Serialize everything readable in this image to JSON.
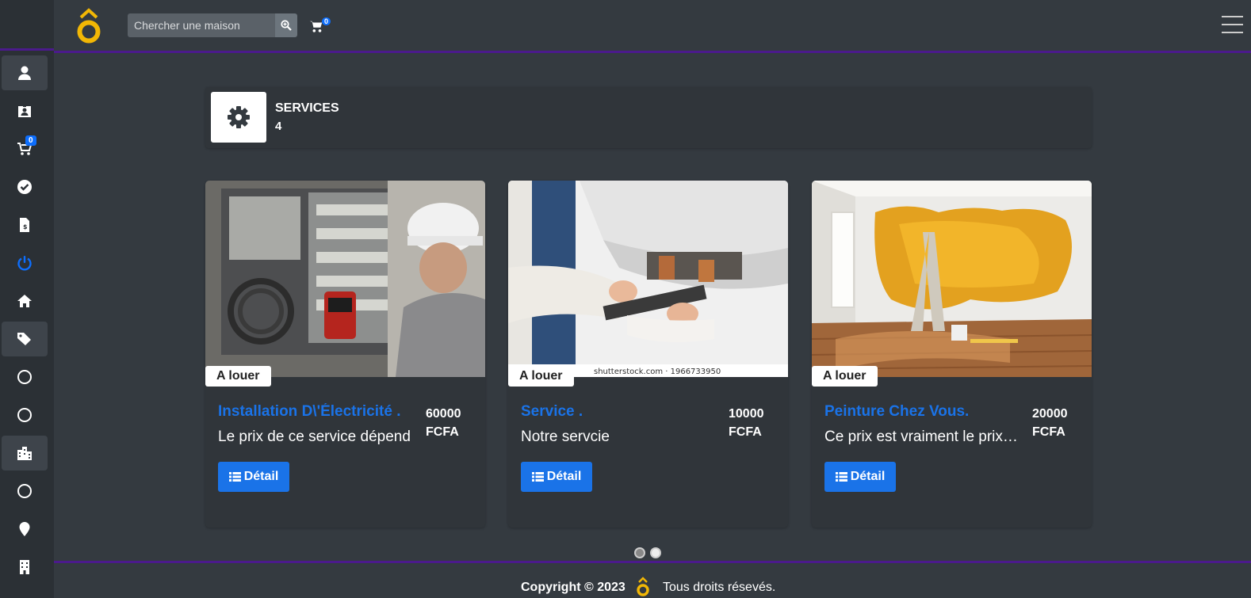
{
  "brand": {
    "logo_glyph": "ô",
    "accent_color": "#f2b705"
  },
  "header": {
    "search_placeholder": "Chercher une maison",
    "cart_count": "0"
  },
  "sidebar": {
    "cart_count": "0",
    "items": [
      {
        "icon": "user-icon",
        "active": true
      },
      {
        "icon": "id-card-icon"
      },
      {
        "icon": "cart-icon"
      },
      {
        "icon": "check-circle-icon"
      },
      {
        "icon": "invoice-icon"
      },
      {
        "icon": "power-icon",
        "color": "#0d6efd"
      },
      {
        "icon": "home-icon"
      },
      {
        "icon": "tags-icon",
        "active": true
      },
      {
        "icon": "circle-icon"
      },
      {
        "icon": "circle-icon"
      },
      {
        "icon": "city-icon",
        "active": true
      },
      {
        "icon": "circle-icon"
      },
      {
        "icon": "map-marker-icon"
      },
      {
        "icon": "building-icon"
      }
    ]
  },
  "services": {
    "title": "SERVICES",
    "count": "4"
  },
  "cards": [
    {
      "tag": "A louer",
      "title": "Installation D\\'Électricité .",
      "desc": "Le prix de ce service dépend",
      "price": "60000",
      "currency": "FCFA",
      "button": "Détail"
    },
    {
      "tag": "A louer",
      "title": "Service .",
      "desc": "Notre servcie",
      "price": "10000",
      "currency": "FCFA",
      "button": "Détail",
      "watermark": "shutterstock.com · 1966733950"
    },
    {
      "tag": "A louer",
      "title": "Peinture Chez Vous.",
      "desc": "Ce prix est vraiment le prix final",
      "price": "20000",
      "currency": "FCFA",
      "button": "Détail"
    }
  ],
  "footer": {
    "copyright": "Copyright © 2023",
    "rights": "Tous droits résevés."
  }
}
